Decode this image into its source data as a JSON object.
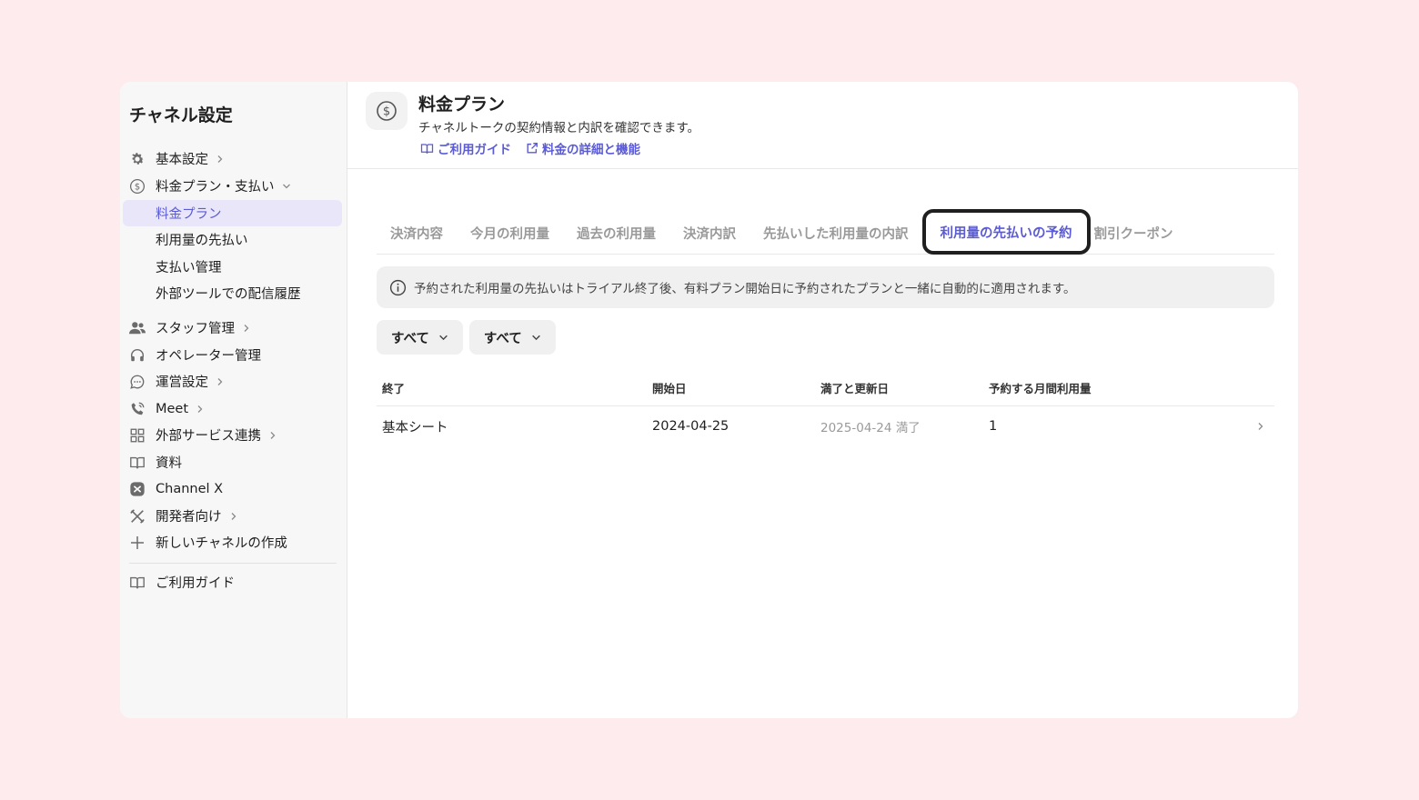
{
  "sidebar": {
    "title": "チャネル設定",
    "items": [
      {
        "label": "基本設定"
      },
      {
        "label": "料金プラン・支払い"
      },
      {
        "label": "料金プラン"
      },
      {
        "label": "利用量の先払い"
      },
      {
        "label": "支払い管理"
      },
      {
        "label": "外部ツールでの配信履歴"
      },
      {
        "label": "スタッフ管理"
      },
      {
        "label": "オペレーター管理"
      },
      {
        "label": "運営設定"
      },
      {
        "label": "Meet"
      },
      {
        "label": "外部サービス連携"
      },
      {
        "label": "資料"
      },
      {
        "label": "Channel X"
      },
      {
        "label": "開発者向け"
      },
      {
        "label": "新しいチャネルの作成"
      },
      {
        "label": "ご利用ガイド"
      }
    ]
  },
  "header": {
    "title": "料金プラン",
    "description": "チャネルトークの契約情報と内訳を確認できます。",
    "link_guide": "ご利用ガイド",
    "link_details": "料金の詳細と機能"
  },
  "tabs": [
    {
      "label": "決済内容"
    },
    {
      "label": "今月の利用量"
    },
    {
      "label": "過去の利用量"
    },
    {
      "label": "決済内訳"
    },
    {
      "label": "先払いした利用量の内訳"
    },
    {
      "label": "利用量の先払いの予約"
    },
    {
      "label": "割引クーポン"
    }
  ],
  "notice": "予約された利用量の先払いはトライアル終了後、有料プラン開始日に予約されたプランと一緒に自動的に適用されます。",
  "filters": [
    {
      "label": "すべて"
    },
    {
      "label": "すべて"
    }
  ],
  "table": {
    "headers": [
      "終了",
      "開始日",
      "満了と更新日",
      "予約する月間利用量"
    ],
    "rows": [
      {
        "name": "基本シート",
        "start": "2024-04-25",
        "expiry": "2025-04-24 満了",
        "monthly": "1"
      }
    ]
  },
  "colors": {
    "accent": "#5b5bd6",
    "background": "#fdebee",
    "sidebar_active": "#e8e6f8"
  }
}
